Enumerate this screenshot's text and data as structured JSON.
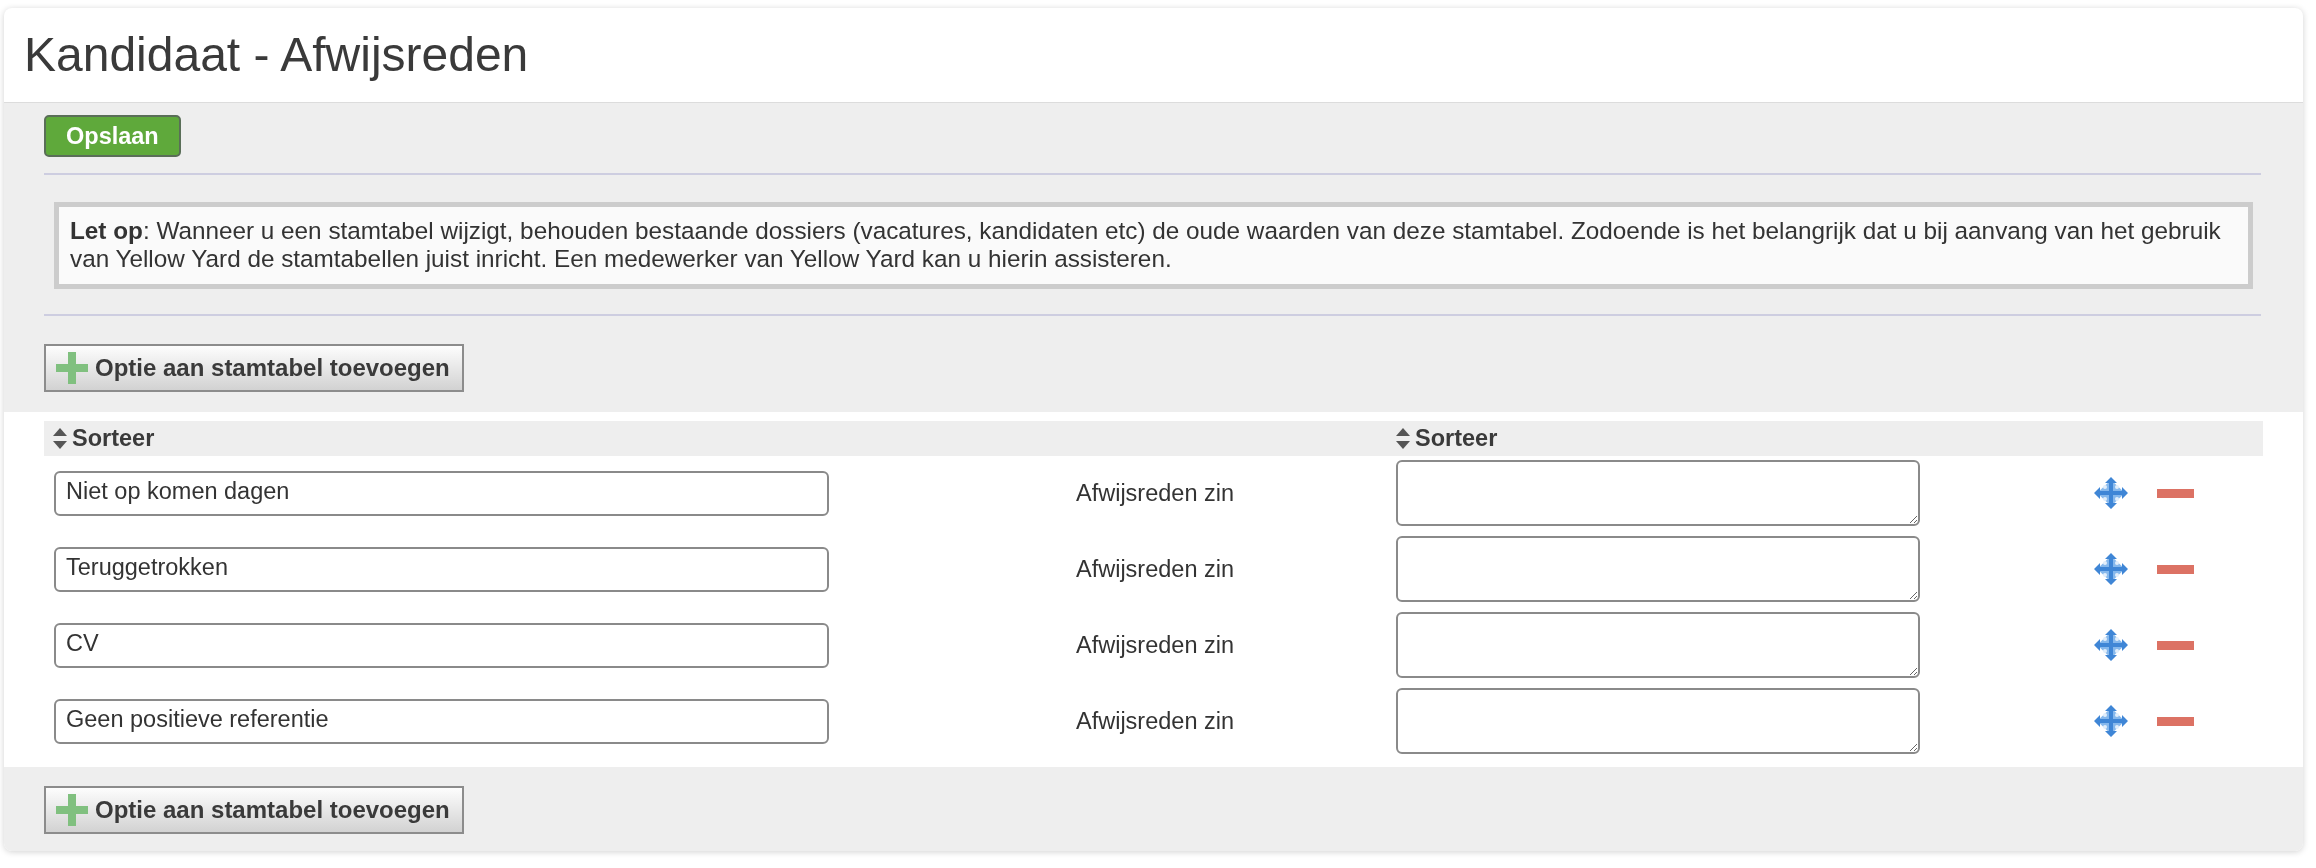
{
  "page": {
    "title": "Kandidaat - Afwijsreden"
  },
  "toolbar": {
    "save_button": "Opslaan"
  },
  "notice": {
    "text": "**Let op**: Wanneer u een stamtabel wijzigt, behouden bestaande dossiers (vacatures, kandidaten etc) de oude waarden van deze stamtabel. Zodoende is het belangrijk dat u bij aanvang van het gebruik van Yellow Yard de stamtabellen juist inricht. Een medewerker van Yellow Yard kan u hierin assisteren."
  },
  "add_option_top": {
    "label": "Optie aan stamtabel toevoegen"
  },
  "table": {
    "header": {
      "column_1": "Sorteer",
      "column_3": "Sorteer"
    },
    "rows": [
      {
        "name": "Niet op komen dagen",
        "phrase_label": "Afwijsreden zin"
      },
      {
        "name": "Teruggetrokken",
        "phrase_label": "Afwijsreden zin"
      },
      {
        "name": "CV",
        "phrase_label": "Afwijsreden zin"
      },
      {
        "name": "Geen positieve referentie",
        "phrase_label": "Afwijsreden zin"
      }
    ]
  },
  "add_option_bottom": {
    "label": "Optie aan stamtabel toevoegen"
  }
}
